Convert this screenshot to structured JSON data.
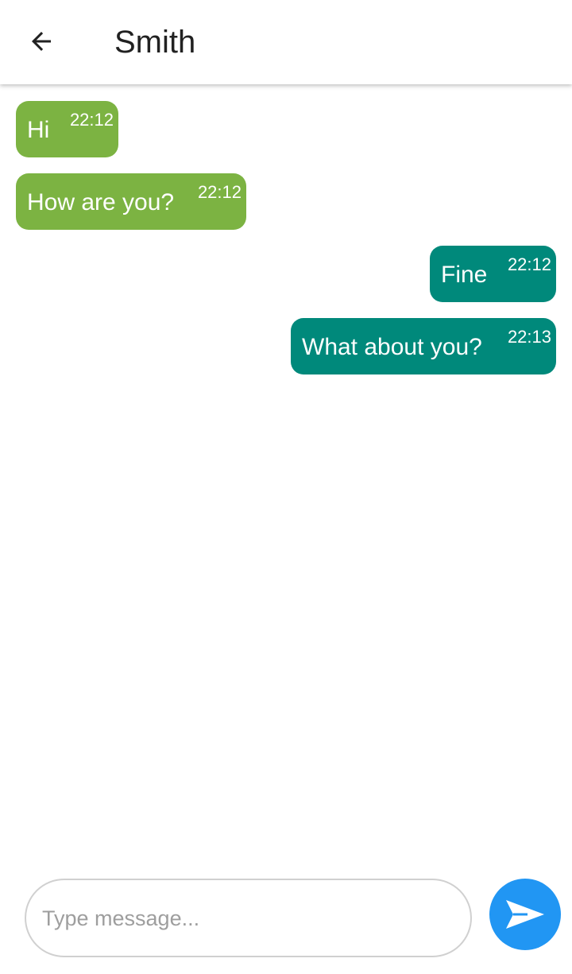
{
  "header": {
    "title": "Smith",
    "back_icon": "arrow-left-icon"
  },
  "messages": [
    {
      "direction": "incoming",
      "text": "Hi",
      "time": "22:12"
    },
    {
      "direction": "incoming",
      "text": "How are you?",
      "time": "22:12"
    },
    {
      "direction": "outgoing",
      "text": "Fine",
      "time": "22:12"
    },
    {
      "direction": "outgoing",
      "text": "What about you?",
      "time": "22:13"
    }
  ],
  "composer": {
    "placeholder": "Type message...",
    "value": "",
    "send_icon": "send-icon"
  },
  "colors": {
    "incoming_bubble": "#7cb342",
    "outgoing_bubble": "#00897b",
    "send_button": "#2196f3"
  }
}
